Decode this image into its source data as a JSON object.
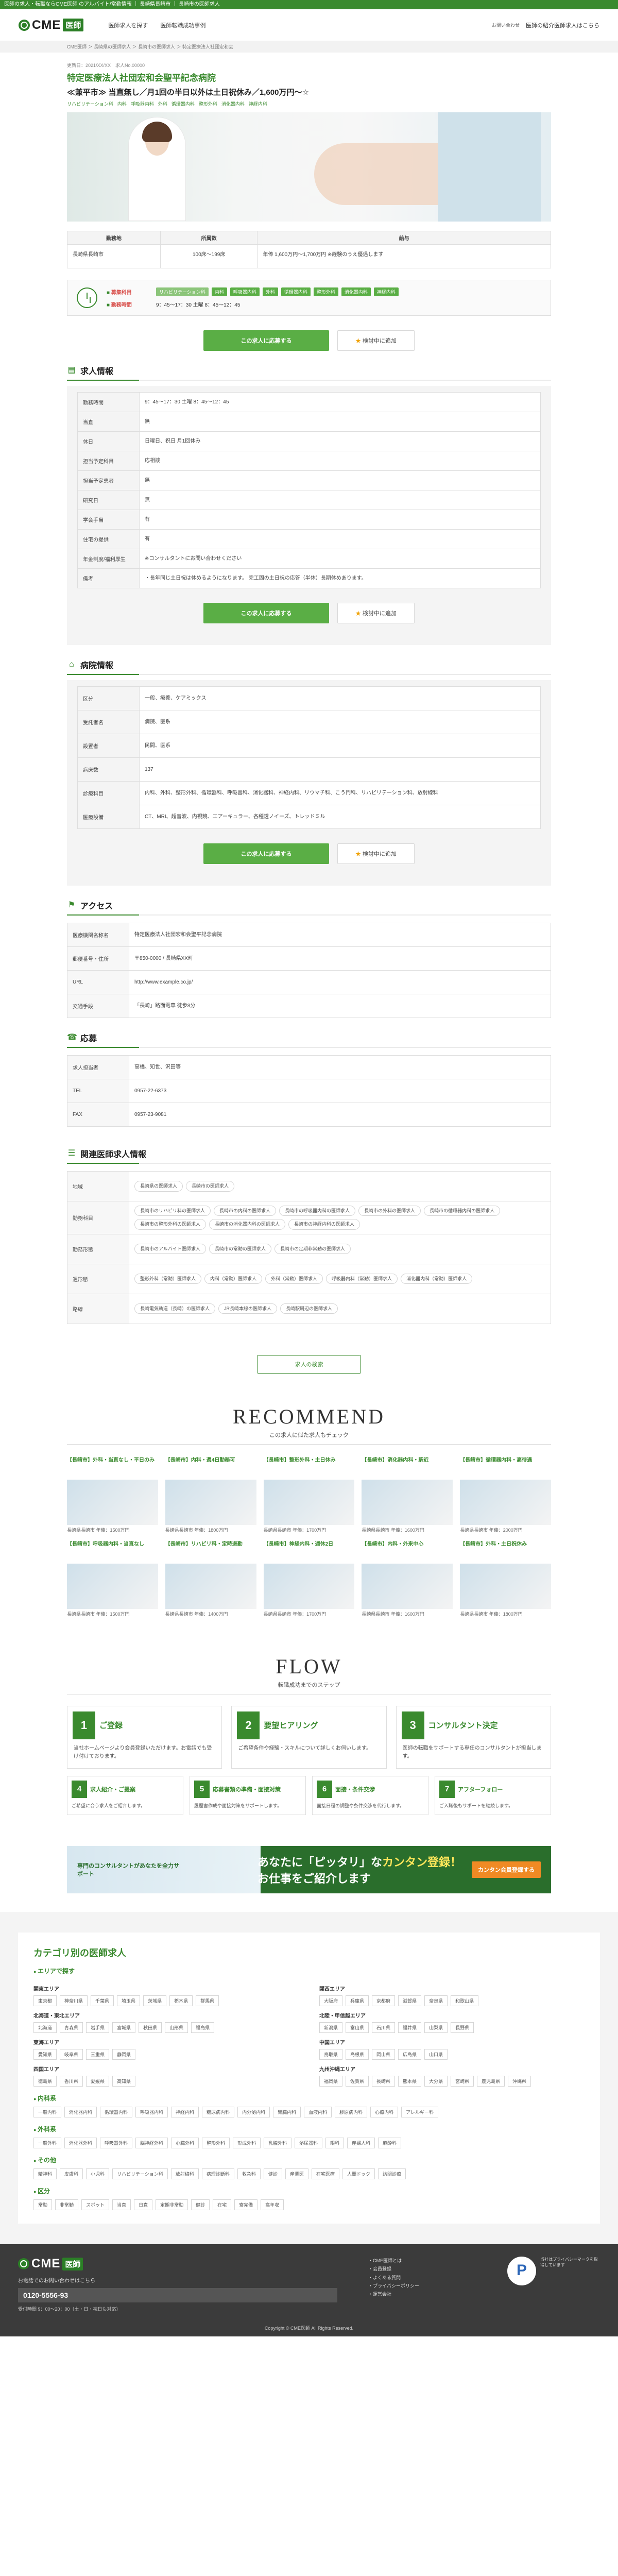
{
  "topbar": {
    "text": "医師の求人・転職ならCME医師 のアルバイト/常勤情報 ｜ 長崎県長崎市 ｜ 長崎市の医師求人"
  },
  "header": {
    "logo_text": "CME",
    "logo_badge": "医師",
    "nav": [
      "医師求人を探す",
      "医師転職成功事例"
    ],
    "tel_label": "お問い合わせ",
    "login_label": "医師の紹介医師求人はこちら"
  },
  "breadcrumb": "CME医師 ＞ 長崎県の医師求人 ＞ 長崎市の医師求人 ＞ 特定医療法人社団宏和会",
  "job": {
    "meta": "更新日：2021/XX/XX　求人No.00000",
    "facility": "特定医療法人社団宏和会聖平記念病院",
    "title": "≪兼平市≫ 当直無し／月1回の半日以外は土日祝休み／1,600万円～☆",
    "tags": [
      "リハビリテーション科",
      "内科",
      "呼吸器内科",
      "外科",
      "循環器内科",
      "整形外科",
      "消化器内科",
      "神経内科"
    ]
  },
  "summary": {
    "headers": [
      "勤務地",
      "所属数",
      "給与"
    ],
    "location": "長崎県長崎市",
    "beds": "100床～199床",
    "salary": "年俸 1,600万円～1,700万円 ※経験のうえ優遇します"
  },
  "schedule": {
    "days_label": "募集科目",
    "days": [
      "リハビリテーション科",
      "内科",
      "呼吸器内科",
      "外科",
      "循環器内科",
      "整形外科",
      "消化器内科",
      "神経内科"
    ],
    "time_label": "勤務時間",
    "time": "9：45～17：30 土曜 8：45～12：45"
  },
  "cta": {
    "apply": "この求人に応募する",
    "fav": "検討中に追加"
  },
  "recruit": {
    "title": "求人情報",
    "rows": [
      {
        "k": "勤務時間",
        "v": "9：45～17：30 土曜 8：45～12：45"
      },
      {
        "k": "当直",
        "v": "無"
      },
      {
        "k": "休日",
        "v": "日曜日、祝日 月1回休み"
      },
      {
        "k": "担当予定科目",
        "v": "応相談"
      },
      {
        "k": "担当予定患者",
        "v": "無"
      },
      {
        "k": "研究日",
        "v": "無"
      },
      {
        "k": "学会手当",
        "v": "有"
      },
      {
        "k": "住宅の提供",
        "v": "有"
      },
      {
        "k": "年金制度/福利厚生",
        "v": "※コンサルタントにお問い合わせください"
      },
      {
        "k": "備考",
        "v": "・長年同じ土日祝は休めるようになります。 完工固の土日祝の応答（半休）長期休めあります。"
      }
    ]
  },
  "hospital": {
    "title": "病院情報",
    "rows": [
      {
        "k": "区分",
        "v": "一般、療養、ケアミックス"
      },
      {
        "k": "受託者名",
        "v": "病院、医系"
      },
      {
        "k": "設置者",
        "v": "民間、医系"
      },
      {
        "k": "病床数",
        "v": "137"
      },
      {
        "k": "診療科目",
        "v": "内科、外科、整形外科、循環器科、呼吸器科、消化器科、神経内科、リウマチ科、こう門科、リハビリテーション科、放射線科"
      },
      {
        "k": "医療設備",
        "v": "CT、MRI、超音波、内視鏡、エアーキュラー、各種透ノイーズ、トレッドミル"
      }
    ]
  },
  "access": {
    "title": "アクセス",
    "rows": [
      {
        "k": "医療機関名称名",
        "v": "特定医療法人社団宏和会聖平記念病院"
      },
      {
        "k": "郵便番号・住所",
        "v": "〒850-0000 / 長崎県XX町"
      },
      {
        "k": "URL",
        "v": "http://www.example.co.jp/"
      },
      {
        "k": "交通手段",
        "v": "「長崎」路面電車 徒歩8分"
      }
    ]
  },
  "apply_info": {
    "title": "応募",
    "rows": [
      {
        "k": "求人担当者",
        "v": "高橋、知世、沢田等"
      },
      {
        "k": "TEL",
        "v": "0957-22-6373"
      },
      {
        "k": "FAX",
        "v": "0957-23-9081"
      }
    ]
  },
  "related": {
    "title": "関連医師求人情報",
    "rows": [
      {
        "k": "地域",
        "v": [
          "長崎県の医師求人",
          "長崎市の医師求人"
        ]
      },
      {
        "k": "勤務科目",
        "v": [
          "長崎市のリハビリ科の医師求人",
          "長崎市の内科の医師求人",
          "長崎市の呼吸器内科の医師求人",
          "長崎市の外科の医師求人",
          "長崎市の循環器内科の医師求人",
          "長崎市の整形外科の医師求人",
          "長崎市の消化器内科の医師求人",
          "長崎市の神経内科の医師求人"
        ]
      },
      {
        "k": "勤務形態",
        "v": [
          "長崎市のアルバイト医師求人",
          "長崎市の常勤の医師求人",
          "長崎市の定期非常勤の医師求人"
        ]
      },
      {
        "k": "週形態",
        "v": [
          "整形外科（常勤）医師求人",
          "内科（常勤）医師求人",
          "外科（常勤）医師求人",
          "呼吸器内科（常勤）医師求人",
          "消化器内科（常勤）医師求人"
        ]
      },
      {
        "k": "路線",
        "v": [
          "長崎電気軌道（長崎）の医師求人",
          "JR長崎本線の医師求人",
          "長崎駅周辺の医師求人"
        ]
      }
    ]
  },
  "search_btn": "求人の検索",
  "recommend": {
    "title": "RECOMMEND",
    "sub": "この求人に似た求人もチェック",
    "cards": [
      {
        "t": "【長崎市】外科・当直なし・平日のみ",
        "i": "長崎県長崎市 年俸：1500万円"
      },
      {
        "t": "【長崎市】内科・週4日勤務可",
        "i": "長崎県長崎市 年俸：1800万円"
      },
      {
        "t": "【長崎市】整形外科・土日休み",
        "i": "長崎県長崎市 年俸：1700万円"
      },
      {
        "t": "【長崎市】消化器内科・駅近",
        "i": "長崎県長崎市 年俸：1600万円"
      },
      {
        "t": "【長崎市】循環器内科・高待遇",
        "i": "長崎県長崎市 年俸：2000万円"
      },
      {
        "t": "【長崎市】呼吸器内科・当直なし",
        "i": "長崎県長崎市 年俸：1500万円"
      },
      {
        "t": "【長崎市】リハビリ科・定時退勤",
        "i": "長崎県長崎市 年俸：1400万円"
      },
      {
        "t": "【長崎市】神経内科・週休2日",
        "i": "長崎県長崎市 年俸：1700万円"
      },
      {
        "t": "【長崎市】内科・外来中心",
        "i": "長崎県長崎市 年俸：1600万円"
      },
      {
        "t": "【長崎市】外科・土日祝休み",
        "i": "長崎県長崎市 年俸：1800万円"
      }
    ]
  },
  "flow": {
    "title": "FLOW",
    "sub": "転職成功までのステップ",
    "steps": [
      {
        "n": "1",
        "name": "ご登録",
        "desc": "当社ホームページより会員登録いただけます。お電話でも受け付けております。"
      },
      {
        "n": "2",
        "name": "要望ヒアリング",
        "desc": "ご希望条件や経験・スキルについて詳しくお伺いします。"
      },
      {
        "n": "3",
        "name": "コンサルタント決定",
        "desc": "医師の転職をサポートする専任のコンサルタントが担当します。"
      }
    ],
    "steps2": [
      {
        "n": "4",
        "name": "求人紹介・ご提案",
        "desc": "ご希望に合う求人をご紹介します。"
      },
      {
        "n": "5",
        "name": "応募書類の準備・面接対策",
        "desc": "履歴書作成や面接対策をサポートします。"
      },
      {
        "n": "6",
        "name": "面接・条件交渉",
        "desc": "面接日程の調整や条件交渉を代行します。"
      },
      {
        "n": "7",
        "name": "アフターフォロー",
        "desc": "ご入職後もサポートを継続します。"
      }
    ]
  },
  "banner": {
    "left": "専門のコンサルタントがあなたを全力サポート",
    "main_a": "あなたに「ピッタリ」な",
    "main_b": "カンタン登録！",
    "main_c": "お仕事をご紹介します",
    "btn": "カンタン会員登録する"
  },
  "category": {
    "title": "カテゴリ別の医師求人",
    "area_h": "エリアで探す",
    "areas": [
      {
        "name": "関東エリア",
        "items": [
          "東京都",
          "神奈川県",
          "千葉県",
          "埼玉県",
          "茨城県",
          "栃木県",
          "群馬県"
        ]
      },
      {
        "name": "関西エリア",
        "items": [
          "大阪府",
          "兵庫県",
          "京都府",
          "滋賀県",
          "奈良県",
          "和歌山県"
        ]
      },
      {
        "name": "北海道・東北エリア",
        "items": [
          "北海道",
          "青森県",
          "岩手県",
          "宮城県",
          "秋田県",
          "山形県",
          "福島県"
        ]
      },
      {
        "name": "北陸・甲信越エリア",
        "items": [
          "新潟県",
          "富山県",
          "石川県",
          "福井県",
          "山梨県",
          "長野県"
        ]
      },
      {
        "name": "東海エリア",
        "items": [
          "愛知県",
          "岐阜県",
          "三重県",
          "静岡県"
        ]
      },
      {
        "name": "中国エリア",
        "items": [
          "鳥取県",
          "島根県",
          "岡山県",
          "広島県",
          "山口県"
        ]
      },
      {
        "name": "四国エリア",
        "items": [
          "徳島県",
          "香川県",
          "愛媛県",
          "高知県"
        ]
      },
      {
        "name": "九州沖縄エリア",
        "items": [
          "福岡県",
          "佐賀県",
          "長崎県",
          "熊本県",
          "大分県",
          "宮崎県",
          "鹿児島県",
          "沖縄県"
        ]
      }
    ],
    "naika_h": "内科系",
    "naika": [
      "一般内科",
      "消化器内科",
      "循環器内科",
      "呼吸器内科",
      "神経内科",
      "糖尿病内科",
      "内分泌内科",
      "腎臓内科",
      "血液内科",
      "膠原病内科",
      "心療内科",
      "アレルギー科"
    ],
    "geka_h": "外科系",
    "geka": [
      "一般外科",
      "消化器外科",
      "呼吸器外科",
      "脳神経外科",
      "心臓外科",
      "整形外科",
      "形成外科",
      "乳腺外科",
      "泌尿器科",
      "眼科",
      "産婦人科",
      "麻酔科"
    ],
    "other_h": "その他",
    "other": [
      "精神科",
      "皮膚科",
      "小児科",
      "リハビリテーション科",
      "放射線科",
      "病理診断科",
      "救急科",
      "健診",
      "産業医",
      "在宅医療",
      "人間ドック",
      "訪問診療"
    ],
    "kubun_h": "区分",
    "kubun": [
      "常勤",
      "非常勤",
      "スポット",
      "当直",
      "日直",
      "定期非常勤",
      "健診",
      "在宅",
      "寮完備",
      "高年収"
    ]
  },
  "footer": {
    "logo_text": "CME",
    "logo_badge": "医師",
    "sub": "お電話でのお問い合わせはこちら",
    "tel": "0120-5556-93",
    "hours": "受付時間 9：00～20：00（土・日・祝日も対応）",
    "links": [
      "CME医師とは",
      "会員登録",
      "よくある質問",
      "プライバシーポリシー",
      "運営会社"
    ],
    "mark_text": "当社はプライバシーマークを取得しています",
    "copyright": "Copyright © CME医師 All Rights Reserved."
  }
}
